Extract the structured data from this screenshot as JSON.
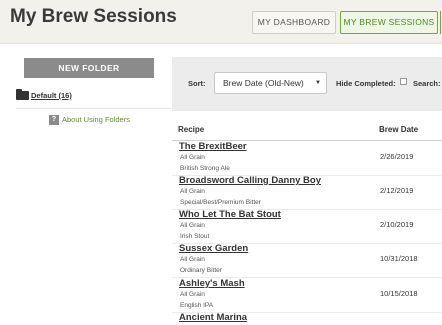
{
  "header": {
    "title": "My Brew Sessions",
    "nav": {
      "dashboard": "MY DASHBOARD",
      "brew_sessions": "MY BREW SESSIONS"
    }
  },
  "sidebar": {
    "new_folder": "NEW FOLDER",
    "folder": {
      "label": "Default (16)",
      "icon": "folder-icon"
    },
    "help": {
      "badge": "?",
      "label": "About Using Folders"
    }
  },
  "filters": {
    "sort_label": "Sort:",
    "sort_value": "Brew Date (Old-New)",
    "hide_completed_label": "Hide Completed:",
    "hide_completed_checked": false,
    "search_label": "Search:"
  },
  "table": {
    "columns": {
      "recipe": "Recipe",
      "brew_date": "Brew Date"
    },
    "rows": [
      {
        "name": "The BrexitBeer",
        "type": "All Grain",
        "style": "British Strong Ale",
        "date": "2/26/2019"
      },
      {
        "name": "Broadsword Calling Danny Boy",
        "type": "All Grain",
        "style": "Special/Best/Premium Bitter",
        "date": "2/12/2019"
      },
      {
        "name": "Who Let The Bat Stout",
        "type": "All Grain",
        "style": "Irish Stout",
        "date": "2/10/2019"
      },
      {
        "name": "Sussex Garden",
        "type": "All Grain",
        "style": "Ordinary Bitter",
        "date": "10/31/2018"
      },
      {
        "name": "Ashley's Mash",
        "type": "All Grain",
        "style": "English IPA",
        "date": "10/15/2018"
      },
      {
        "name": "Ancient Marina",
        "type": "",
        "style": "",
        "date": ""
      }
    ]
  },
  "colors": {
    "accent_green": "#4f8a20",
    "button_gray": "#8b8b8b",
    "header_bg": "#f2f1ec"
  }
}
